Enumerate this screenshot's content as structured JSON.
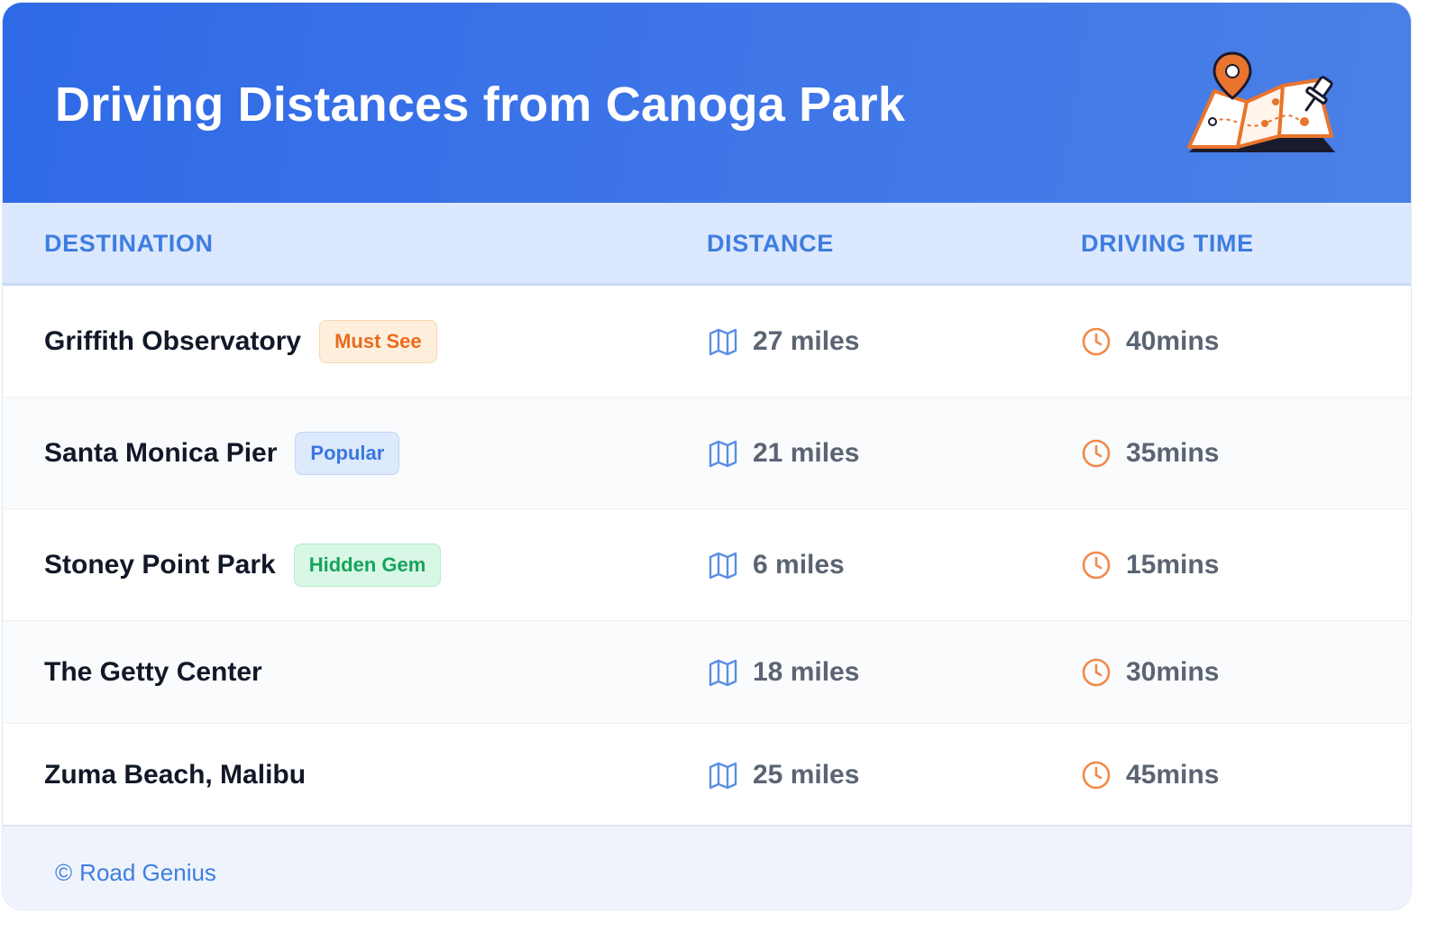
{
  "header": {
    "title": "Driving Distances from Canoga Park",
    "illustration_icon": "folded-map-with-pins-icon"
  },
  "columns": {
    "destination": "DESTINATION",
    "distance": "DISTANCE",
    "driving_time": "DRIVING TIME"
  },
  "rows": [
    {
      "destination": "Griffith Observatory",
      "badge": "Must See",
      "badge_color": "#ea6b1e",
      "distance": "27 miles",
      "time": "40mins"
    },
    {
      "destination": "Santa Monica Pier",
      "badge": "Popular",
      "badge_color": "#3b78dd",
      "distance": "21 miles",
      "time": "35mins"
    },
    {
      "destination": "Stoney Point Park",
      "badge": "Hidden Gem",
      "badge_color": "#17a45c",
      "distance": "6 miles",
      "time": "15mins"
    },
    {
      "destination": "The Getty Center",
      "badge": "",
      "distance": "18 miles",
      "time": "30mins"
    },
    {
      "destination": "Zuma Beach, Malibu",
      "badge": "",
      "distance": "25 miles",
      "time": "45mins"
    }
  ],
  "icons": {
    "distance": "map-icon",
    "time": "clock-icon"
  },
  "footer": {
    "copyright_symbol": "©",
    "brand": "Road Genius"
  },
  "colors": {
    "header_blue": "#3470e6",
    "accent_blue": "#3f7de0",
    "accent_orange": "#f08a4b"
  }
}
